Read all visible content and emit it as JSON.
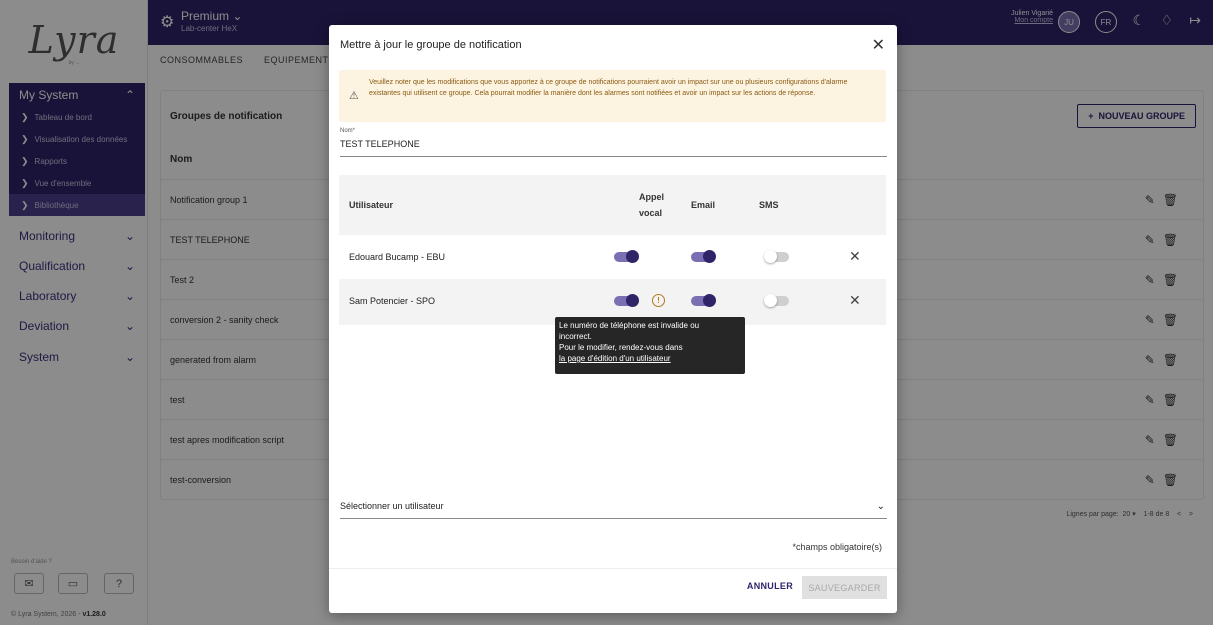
{
  "sidebar": {
    "logo": "Lyra",
    "logo_by": "by ...",
    "sections": [
      {
        "label": "My System",
        "chev": "^",
        "active": true
      },
      {
        "label": "Monitoring",
        "chev": "v"
      },
      {
        "label": "Qualification",
        "chev": "v"
      },
      {
        "label": "Laboratory",
        "chev": "v"
      },
      {
        "label": "Deviation",
        "chev": "v"
      },
      {
        "label": "System",
        "chev": "v"
      }
    ],
    "subitems": [
      "Tableau de bord",
      "Visualisation des données",
      "Rapports",
      "Vue d'ensemble",
      "Bibliothèque"
    ],
    "help_label": "Besoin d'aide ?",
    "copyright": "© Lyra System, 2026 -",
    "version": "v1.28.0"
  },
  "topbar": {
    "title": "Premium",
    "subtitle": "Lab-center HeX",
    "user_name": "Julien Vigarié",
    "account_link": "Mon compte",
    "avatar": "JU",
    "lang": "FR"
  },
  "main": {
    "tabs": [
      "CONSOMMABLES",
      "EQUIPEMENTS"
    ],
    "card_title": "Groupes de notification",
    "col_name": "Nom",
    "new_group": "NOUVEAU GROUPE",
    "rows": [
      "Notification group 1",
      "TEST TELEPHONE",
      "Test 2",
      "conversion 2 - sanity check",
      "generated from alarm",
      "test",
      "test apres modification script",
      "test-conversion"
    ],
    "pager_label": "Lignes par page:",
    "pager_value": "20",
    "pager_range": "1-8 de 8"
  },
  "modal": {
    "title": "Mettre à jour le groupe de notification",
    "warning": "Veuillez noter que les modifications que vous apportez à ce groupe de notifications pourraient avoir un impact sur une ou plusieurs configurations d'alarme existantes qui utilisent ce groupe. Cela pourrait modifier la manière dont les alarmes sont notifiées et avoir un impact sur les actions de réponse.",
    "name_label": "Nom*",
    "name_value": "TEST TELEPHONE",
    "col_user": "Utilisateur",
    "col_voice_1": "Appel",
    "col_voice_2": "vocal",
    "col_email": "Email",
    "col_sms": "SMS",
    "users": [
      {
        "name": "Edouard Bucamp - EBU",
        "voice": true,
        "email": true,
        "sms": false
      },
      {
        "name": "Sam Potencier - SPO",
        "voice": true,
        "email": true,
        "sms": false
      }
    ],
    "tooltip_l1": "Le numéro de téléphone est invalide ou",
    "tooltip_l2": "incorrect.",
    "tooltip_l3": "Pour le modifier, rendez-vous dans",
    "tooltip_link": "la page d'édition d'un utilisateur",
    "select_user": "Sélectionner un utilisateur",
    "required": "*champs obligatoire(s)",
    "cancel": "ANNULER",
    "save": "SAUVEGARDER"
  }
}
